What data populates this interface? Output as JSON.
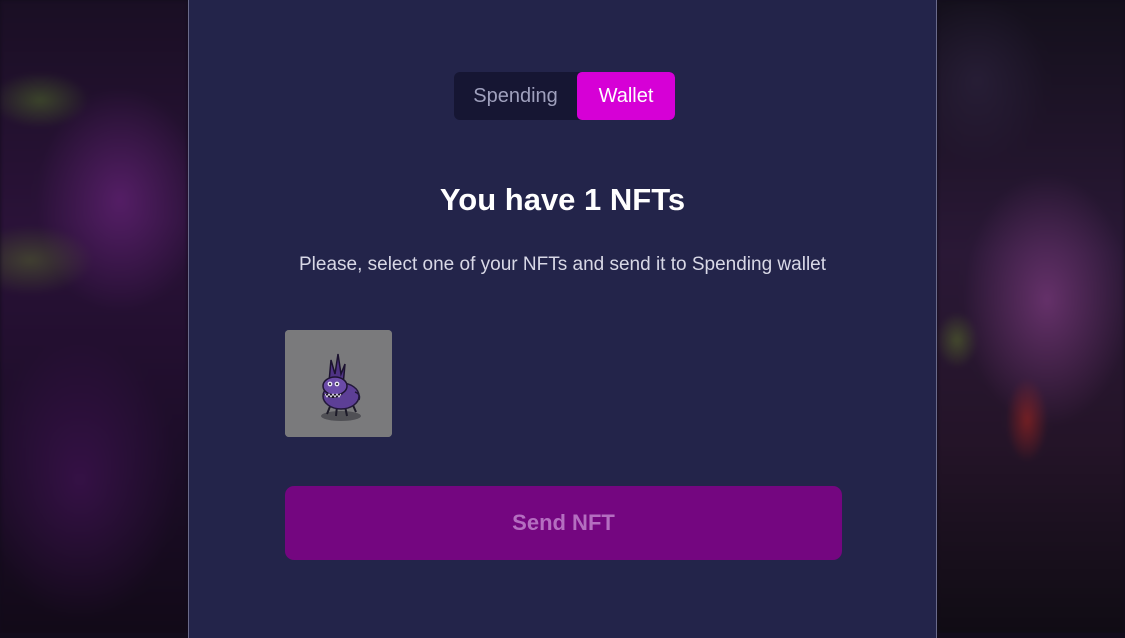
{
  "toggle": {
    "spending_label": "Spending",
    "wallet_label": "Wallet",
    "active": "Wallet"
  },
  "title": "You have 1 NFTs",
  "subtitle": "Please, select one of your NFTs and send it to Spending wallet",
  "nfts": [
    {
      "image": "purple-creature-nft-image"
    }
  ],
  "send_button_label": "Send NFT",
  "colors": {
    "modal_background": "#23244a",
    "toggle_active": "#d600d6",
    "send_button": "#740680",
    "send_button_text": "#b46ec0"
  }
}
